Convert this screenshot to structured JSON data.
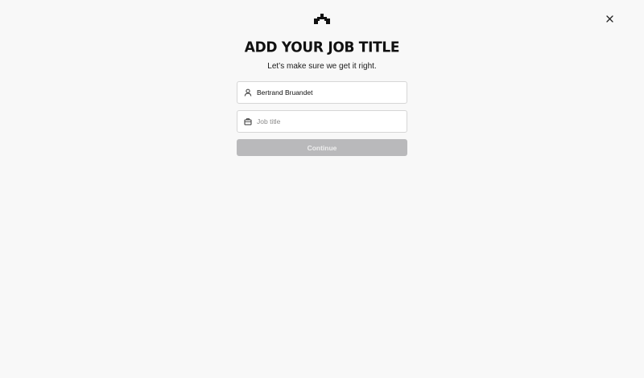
{
  "header": {
    "logo_icon": "brand-logo-icon",
    "close_icon": "close-icon"
  },
  "main": {
    "title": "ADD YOUR JOB TITLE",
    "subtitle": "Let’s make sure we get it right.",
    "name_field": {
      "icon": "person-icon",
      "value": "Bertrand Bruandet",
      "placeholder": ""
    },
    "job_field": {
      "icon": "briefcase-icon",
      "value": "",
      "placeholder": "Job title"
    },
    "continue_label": "Continue",
    "continue_disabled": true
  },
  "colors": {
    "background": "#f8f8f8",
    "button_disabled": "#b9b9bb",
    "text": "#111111"
  }
}
